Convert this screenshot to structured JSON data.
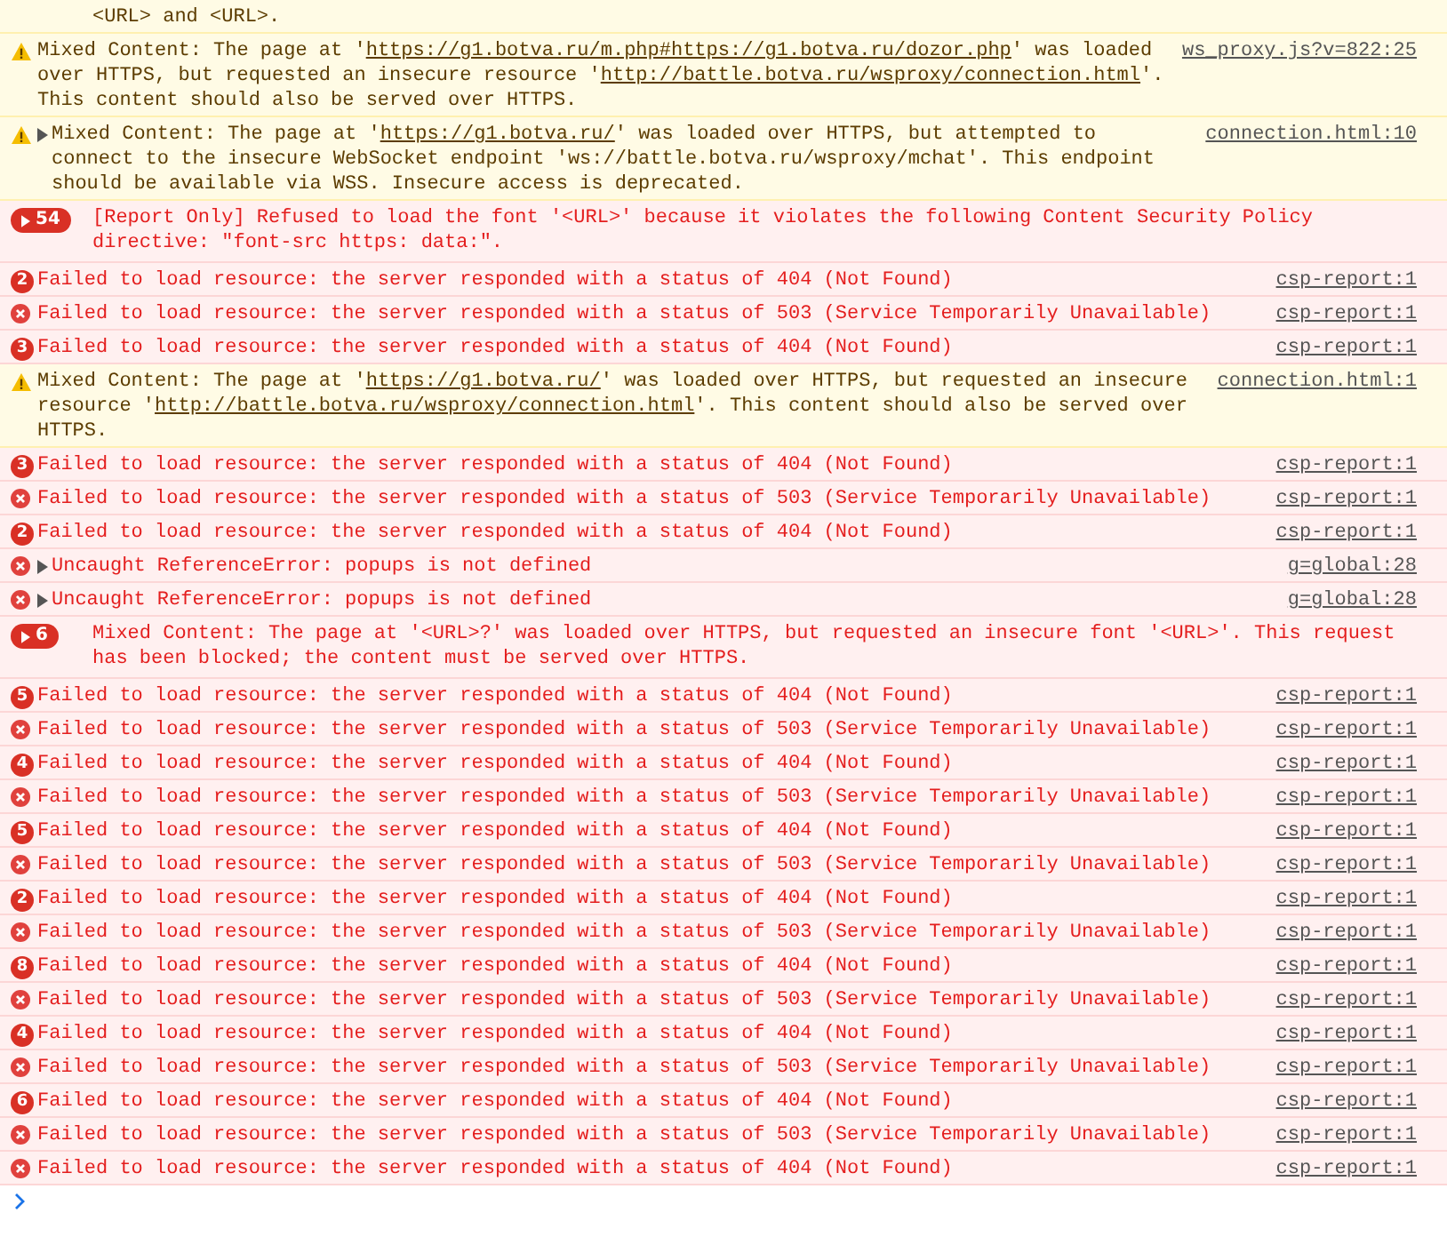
{
  "messages": [
    {
      "kind": "warning",
      "partial": true,
      "parts": [
        {
          "text": "<URL> and <URL>."
        }
      ]
    },
    {
      "kind": "warning",
      "parts": [
        {
          "text": "Mixed Content: The page at '"
        },
        {
          "link": "https://g1.botva.ru/m.php#https://g1.botva.ru/dozor.php"
        },
        {
          "text": "' was loaded over HTTPS, but requested an insecure resource '"
        },
        {
          "link": "http://battle.botva.ru/wsproxy/connection.html"
        },
        {
          "text": "'. This content should also be served over HTTPS."
        }
      ],
      "source": "ws_proxy.js?v=822:25"
    },
    {
      "kind": "warning",
      "expandable": true,
      "parts": [
        {
          "text": "Mixed Content: The page at '"
        },
        {
          "link": "https://g1.botva.ru/"
        },
        {
          "text": "' was loaded over HTTPS, but attempted to connect to the insecure WebSocket endpoint 'ws://battle.botva.ru/wsproxy/mchat'. This endpoint should be available via WSS. Insecure access is deprecated."
        }
      ],
      "source": "connection.html:10"
    },
    {
      "kind": "error",
      "count": "54",
      "grouped": true,
      "parts": [
        {
          "text": "[Report Only] Refused to load the font '<URL>' because it violates the following Content Security Policy directive: \"font-src https: data:\"."
        }
      ]
    },
    {
      "kind": "error",
      "count": "2",
      "grouped": false,
      "parts": [
        {
          "text": "Failed to load resource: the server responded with a status of 404 (Not Found)"
        }
      ],
      "source": "csp-report:1"
    },
    {
      "kind": "error",
      "parts": [
        {
          "text": "Failed to load resource: the server responded with a status of 503 (Service Temporarily Unavailable)"
        }
      ],
      "source": "csp-report:1"
    },
    {
      "kind": "error",
      "count": "3",
      "grouped": false,
      "parts": [
        {
          "text": "Failed to load resource: the server responded with a status of 404 (Not Found)"
        }
      ],
      "source": "csp-report:1"
    },
    {
      "kind": "warning",
      "parts": [
        {
          "text": "Mixed Content: The page at '"
        },
        {
          "link": "https://g1.botva.ru/"
        },
        {
          "text": "' was loaded over HTTPS, but requested an insecure resource '"
        },
        {
          "link": "http://battle.botva.ru/wsproxy/connection.html"
        },
        {
          "text": "'. This content should also be served over HTTPS."
        }
      ],
      "source": "connection.html:1"
    },
    {
      "kind": "error",
      "count": "3",
      "grouped": false,
      "parts": [
        {
          "text": "Failed to load resource: the server responded with a status of 404 (Not Found)"
        }
      ],
      "source": "csp-report:1"
    },
    {
      "kind": "error",
      "parts": [
        {
          "text": "Failed to load resource: the server responded with a status of 503 (Service Temporarily Unavailable)"
        }
      ],
      "source": "csp-report:1"
    },
    {
      "kind": "error",
      "count": "2",
      "grouped": false,
      "parts": [
        {
          "text": "Failed to load resource: the server responded with a status of 404 (Not Found)"
        }
      ],
      "source": "csp-report:1"
    },
    {
      "kind": "error",
      "expandable": true,
      "parts": [
        {
          "text": "Uncaught ReferenceError: popups is not defined"
        }
      ],
      "source": "g=global:28"
    },
    {
      "kind": "error",
      "expandable": true,
      "parts": [
        {
          "text": "Uncaught ReferenceError: popups is not defined"
        }
      ],
      "source": "g=global:28"
    },
    {
      "kind": "error",
      "count": "6",
      "grouped": true,
      "parts": [
        {
          "text": "Mixed Content: The page at '<URL>?' was loaded over HTTPS, but requested an insecure font '<URL>'. This request has been blocked; the content must be served over HTTPS."
        }
      ]
    },
    {
      "kind": "error",
      "count": "5",
      "grouped": false,
      "parts": [
        {
          "text": "Failed to load resource: the server responded with a status of 404 (Not Found)"
        }
      ],
      "source": "csp-report:1"
    },
    {
      "kind": "error",
      "parts": [
        {
          "text": "Failed to load resource: the server responded with a status of 503 (Service Temporarily Unavailable)"
        }
      ],
      "source": "csp-report:1"
    },
    {
      "kind": "error",
      "count": "4",
      "grouped": false,
      "parts": [
        {
          "text": "Failed to load resource: the server responded with a status of 404 (Not Found)"
        }
      ],
      "source": "csp-report:1"
    },
    {
      "kind": "error",
      "parts": [
        {
          "text": "Failed to load resource: the server responded with a status of 503 (Service Temporarily Unavailable)"
        }
      ],
      "source": "csp-report:1"
    },
    {
      "kind": "error",
      "count": "5",
      "grouped": false,
      "parts": [
        {
          "text": "Failed to load resource: the server responded with a status of 404 (Not Found)"
        }
      ],
      "source": "csp-report:1"
    },
    {
      "kind": "error",
      "parts": [
        {
          "text": "Failed to load resource: the server responded with a status of 503 (Service Temporarily Unavailable)"
        }
      ],
      "source": "csp-report:1"
    },
    {
      "kind": "error",
      "count": "2",
      "grouped": false,
      "parts": [
        {
          "text": "Failed to load resource: the server responded with a status of 404 (Not Found)"
        }
      ],
      "source": "csp-report:1"
    },
    {
      "kind": "error",
      "parts": [
        {
          "text": "Failed to load resource: the server responded with a status of 503 (Service Temporarily Unavailable)"
        }
      ],
      "source": "csp-report:1"
    },
    {
      "kind": "error",
      "count": "8",
      "grouped": false,
      "parts": [
        {
          "text": "Failed to load resource: the server responded with a status of 404 (Not Found)"
        }
      ],
      "source": "csp-report:1"
    },
    {
      "kind": "error",
      "parts": [
        {
          "text": "Failed to load resource: the server responded with a status of 503 (Service Temporarily Unavailable)"
        }
      ],
      "source": "csp-report:1"
    },
    {
      "kind": "error",
      "count": "4",
      "grouped": false,
      "parts": [
        {
          "text": "Failed to load resource: the server responded with a status of 404 (Not Found)"
        }
      ],
      "source": "csp-report:1"
    },
    {
      "kind": "error",
      "parts": [
        {
          "text": "Failed to load resource: the server responded with a status of 503 (Service Temporarily Unavailable)"
        }
      ],
      "source": "csp-report:1"
    },
    {
      "kind": "error",
      "count": "6",
      "grouped": false,
      "parts": [
        {
          "text": "Failed to load resource: the server responded with a status of 404 (Not Found)"
        }
      ],
      "source": "csp-report:1"
    },
    {
      "kind": "error",
      "parts": [
        {
          "text": "Failed to load resource: the server responded with a status of 503 (Service Temporarily Unavailable)"
        }
      ],
      "source": "csp-report:1"
    },
    {
      "kind": "error",
      "parts": [
        {
          "text": "Failed to load resource: the server responded with a status of 404 (Not Found)"
        }
      ],
      "source": "csp-report:1"
    }
  ]
}
